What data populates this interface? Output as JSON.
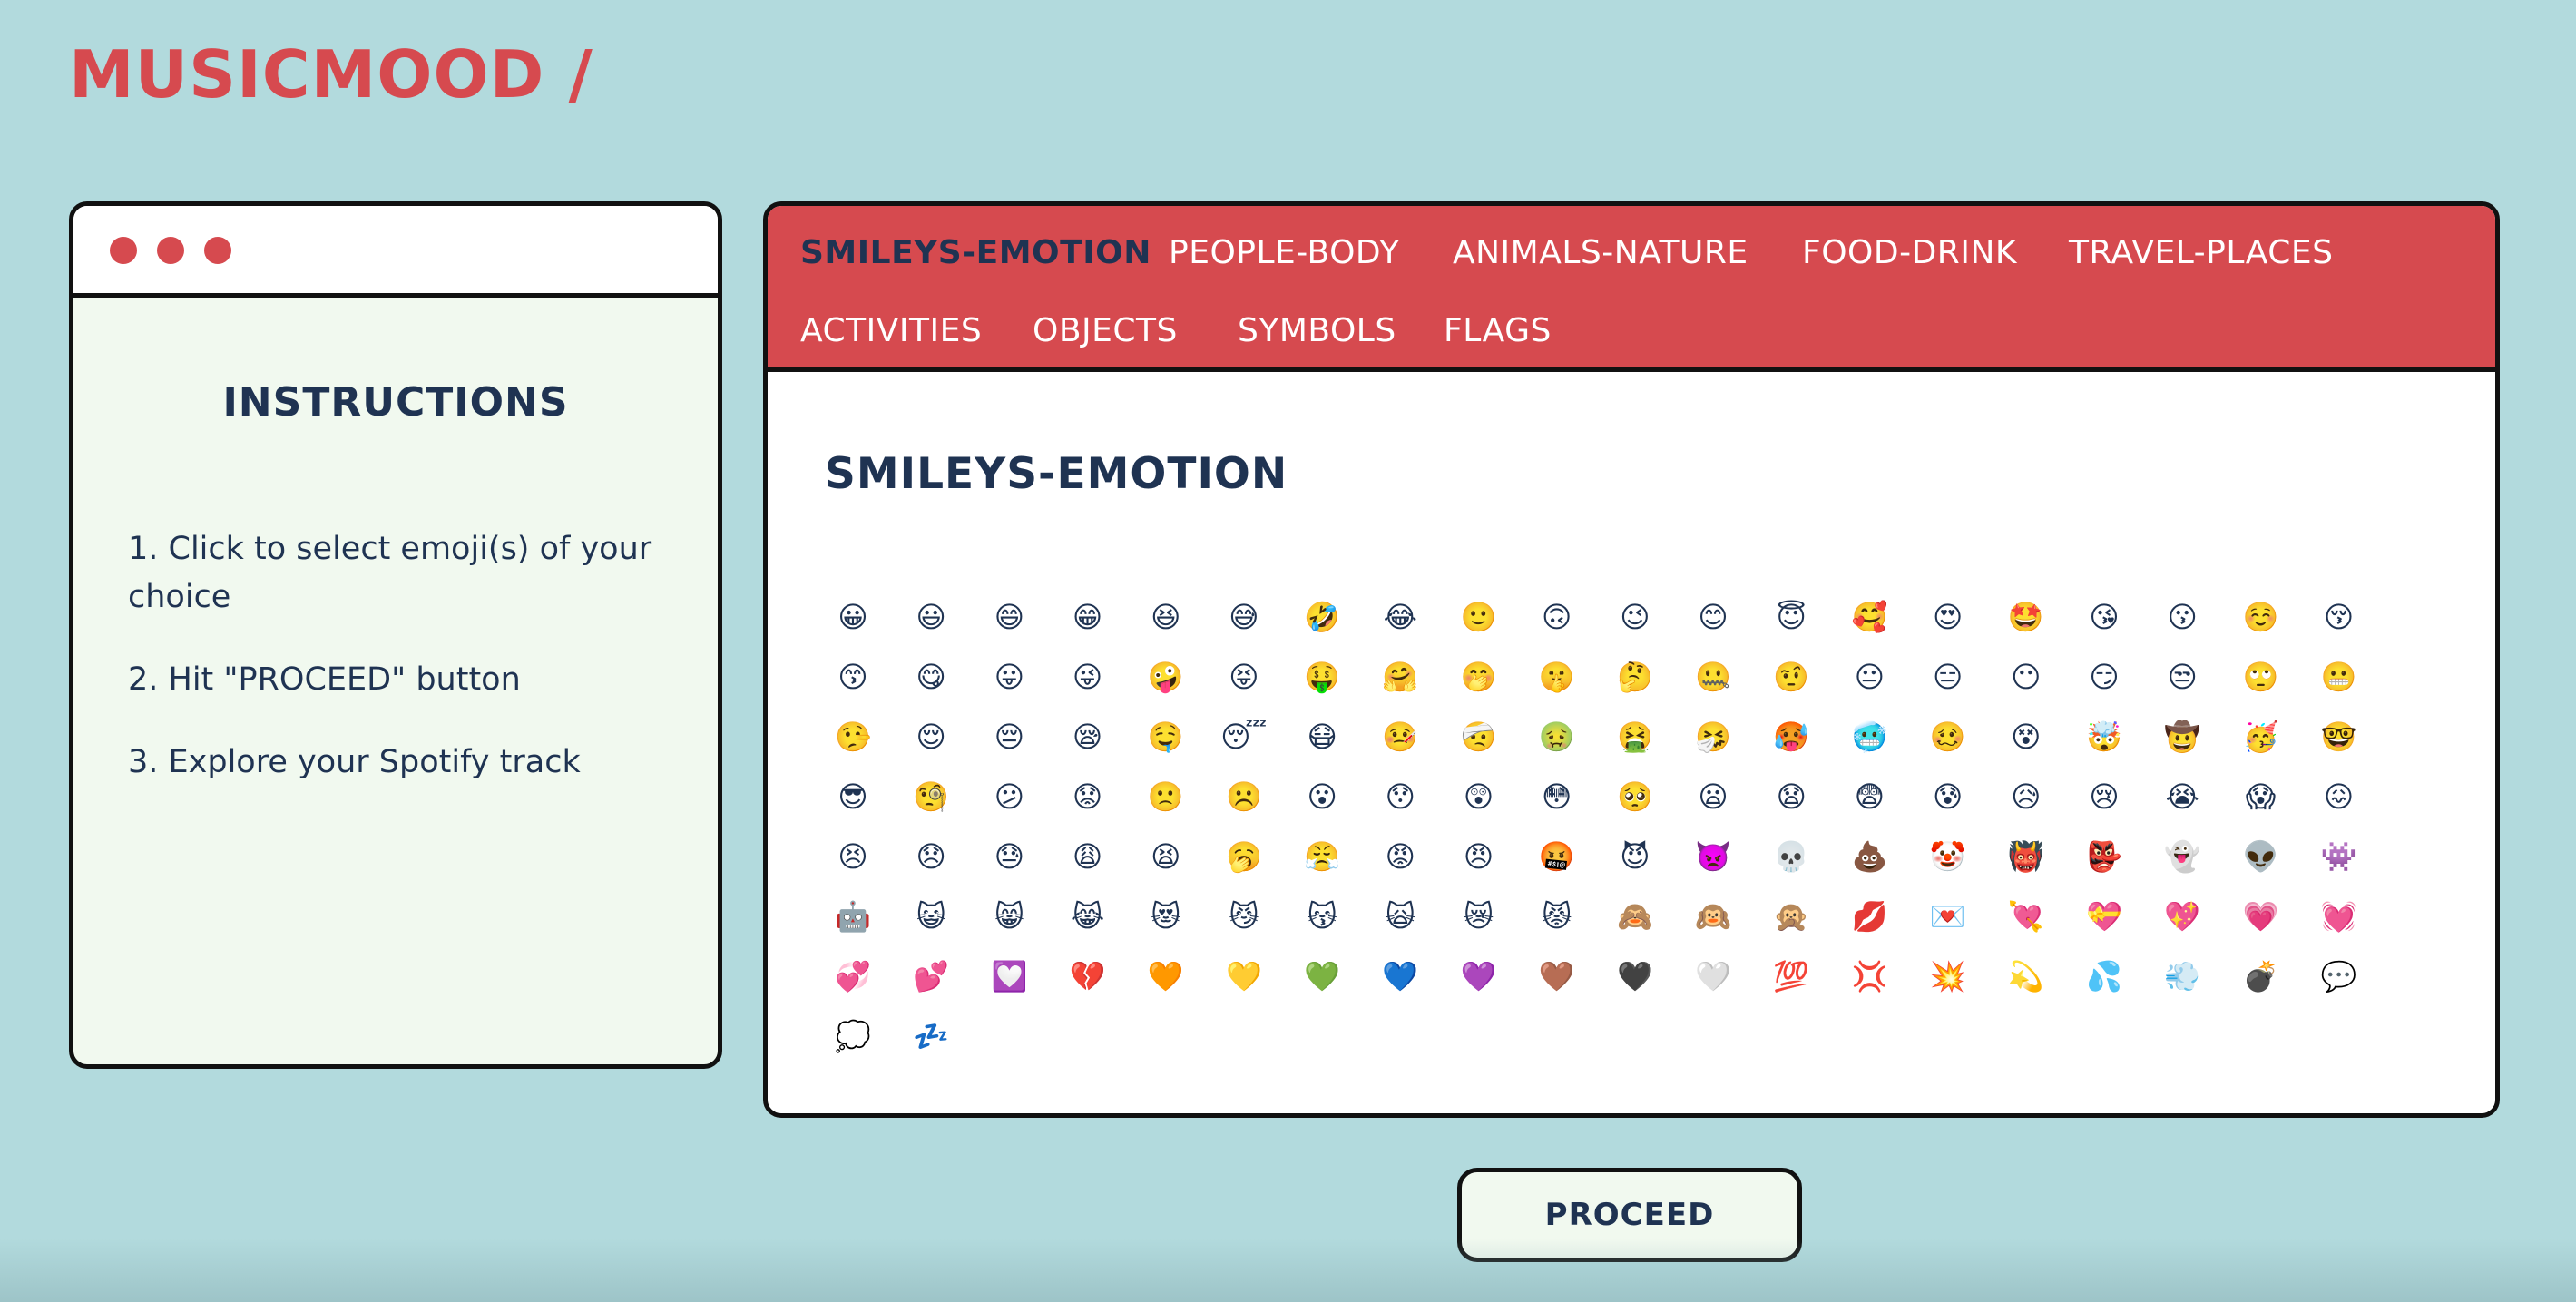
{
  "app": {
    "logo": "MUSICMOOD /"
  },
  "instructions": {
    "title": "INSTRUCTIONS",
    "steps": [
      "1. Click to select emoji(s) of your choice",
      "2. Hit \"PROCEED\" button",
      "3. Explore your Spotify track"
    ]
  },
  "tabs": [
    {
      "label": "SMILEYS-EMOTION",
      "active": true
    },
    {
      "label": "PEOPLE-BODY",
      "active": false
    },
    {
      "label": "ANIMALS-NATURE",
      "active": false
    },
    {
      "label": "FOOD-DRINK",
      "active": false
    },
    {
      "label": "TRAVEL-PLACES",
      "active": false
    },
    {
      "label": "ACTIVITIES",
      "active": false
    },
    {
      "label": "OBJECTS",
      "active": false
    },
    {
      "label": "SYMBOLS",
      "active": false
    },
    {
      "label": "FLAGS",
      "active": false
    }
  ],
  "category": {
    "title": "SMILEYS-EMOTION",
    "emojis": [
      "😀",
      "😃",
      "😄",
      "😁",
      "😆",
      "😅",
      "🤣",
      "😂",
      "🙂",
      "🙃",
      "😉",
      "😊",
      "😇",
      "🥰",
      "😍",
      "🤩",
      "😘",
      "😗",
      "☺️",
      "😚",
      "😙",
      "😋",
      "😛",
      "😜",
      "🤪",
      "😝",
      "🤑",
      "🤗",
      "🤭",
      "🤫",
      "🤔",
      "🤐",
      "🤨",
      "😐",
      "😑",
      "😶",
      "😏",
      "😒",
      "🙄",
      "😬",
      "🤥",
      "😌",
      "😔",
      "😪",
      "🤤",
      "😴",
      "😷",
      "🤒",
      "🤕",
      "🤢",
      "🤮",
      "🤧",
      "🥵",
      "🥶",
      "🥴",
      "😵",
      "🤯",
      "🤠",
      "🥳",
      "🤓",
      "😎",
      "🧐",
      "😕",
      "😟",
      "🙁",
      "☹️",
      "😮",
      "😯",
      "😲",
      "😳",
      "🥺",
      "😦",
      "😧",
      "😨",
      "😰",
      "😥",
      "😢",
      "😭",
      "😱",
      "😖",
      "😣",
      "😞",
      "😓",
      "😩",
      "😫",
      "🥱",
      "😤",
      "😡",
      "😠",
      "🤬",
      "😈",
      "👿",
      "💀",
      "💩",
      "🤡",
      "👹",
      "👺",
      "👻",
      "👽",
      "👾",
      "🤖",
      "😺",
      "😸",
      "😹",
      "😻",
      "😼",
      "😽",
      "🙀",
      "😿",
      "😾",
      "🙈",
      "🙉",
      "🙊",
      "💋",
      "💌",
      "💘",
      "💝",
      "💖",
      "💗",
      "💓",
      "💞",
      "💕",
      "💟",
      "💔",
      "🧡",
      "💛",
      "💚",
      "💙",
      "💜",
      "🤎",
      "🖤",
      "🤍",
      "💯",
      "💢",
      "💥",
      "💫",
      "💦",
      "💨",
      "💣",
      "💬",
      "💭",
      "💤"
    ]
  },
  "actions": {
    "proceed_label": "PROCEED"
  },
  "colors": {
    "background": "#b2dadd",
    "accent": "#d64a4f",
    "text": "#1f3352",
    "panel_light": "#f1f9ef"
  }
}
